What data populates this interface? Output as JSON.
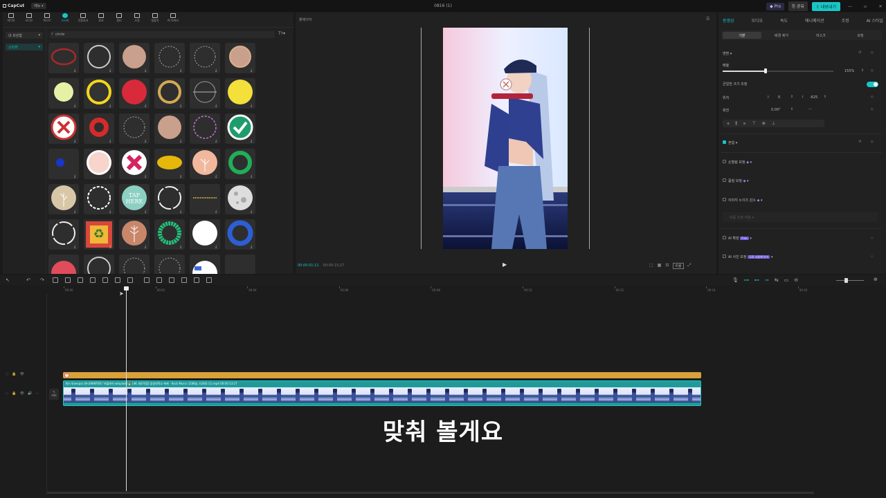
{
  "app": {
    "name": "CapCut",
    "menu_label": "메뉴",
    "project_title": "0816 (1)"
  },
  "top_buttons": {
    "pro": "Pro",
    "share": "공유",
    "export": "내보내기"
  },
  "toolbar": [
    {
      "label": "미디어",
      "icon": "media-icon"
    },
    {
      "label": "오디오",
      "icon": "audio-icon"
    },
    {
      "label": "텍스트",
      "icon": "text-icon"
    },
    {
      "label": "스티커",
      "icon": "sticker-icon",
      "active": true
    },
    {
      "label": "전환효과",
      "icon": "transition-icon"
    },
    {
      "label": "효과",
      "icon": "effect-icon"
    },
    {
      "label": "필터",
      "icon": "filter-icon"
    },
    {
      "label": "조정",
      "icon": "adjust-icon"
    },
    {
      "label": "템플릿",
      "icon": "template-icon"
    },
    {
      "label": "AI 아바타",
      "icon": "avatar-icon"
    }
  ],
  "sidebar": {
    "my_label": "내 보관함",
    "sticker_label": "스티커"
  },
  "search": {
    "value": "circle"
  },
  "sticker_grid": [
    {
      "kind": "red-ring"
    },
    {
      "kind": "gray-ring"
    },
    {
      "kind": "tan-circle"
    },
    {
      "kind": "dotted-ring"
    },
    {
      "kind": "dotted-ring"
    },
    {
      "kind": "tan-circle-ring"
    },
    {
      "kind": "lime-circle"
    },
    {
      "kind": "yellow-ring"
    },
    {
      "kind": "red-circle"
    },
    {
      "kind": "gold-ring"
    },
    {
      "kind": "line-ring"
    },
    {
      "kind": "yellow-circle"
    },
    {
      "kind": "x-circle"
    },
    {
      "kind": "red-target"
    },
    {
      "kind": "dotted-ring"
    },
    {
      "kind": "tan-circle"
    },
    {
      "kind": "pink-dash-ring"
    },
    {
      "kind": "check-circle"
    },
    {
      "kind": "blue-dot"
    },
    {
      "kind": "pink-circle"
    },
    {
      "kind": "x-pink"
    },
    {
      "kind": "yellow-ellipse"
    },
    {
      "kind": "peach-flower"
    },
    {
      "kind": "green-ring"
    },
    {
      "kind": "beige-flower"
    },
    {
      "kind": "laurel-ring"
    },
    {
      "kind": "tap-here"
    },
    {
      "kind": "brush-ring"
    },
    {
      "kind": "gold-dots"
    },
    {
      "kind": "moon"
    },
    {
      "kind": "brush-ring"
    },
    {
      "kind": "recycle"
    },
    {
      "kind": "leaf-circle"
    },
    {
      "kind": "green-dash-ring"
    },
    {
      "kind": "white-circle"
    },
    {
      "kind": "blue-ring"
    },
    {
      "kind": "red-partial"
    },
    {
      "kind": "gray-ring"
    },
    {
      "kind": "dotted-ring"
    },
    {
      "kind": "dotted-ring"
    },
    {
      "kind": "white-blue"
    },
    {
      "kind": "empty"
    }
  ],
  "tap_here_text": "TAP HERE",
  "player": {
    "header": "플레이어",
    "current_time": "00:00:01:11",
    "total_time": "00:00:13:27",
    "ratio_label": "비율"
  },
  "right_panel": {
    "tabs": [
      "동영상",
      "오디오",
      "속도",
      "애니메이션",
      "조정",
      "AI 스타일"
    ],
    "subtabs": [
      "기본",
      "배경 제거",
      "마스크",
      "보정"
    ],
    "transform": "변환",
    "scale_label": "배율",
    "scale_value": "155%",
    "uniform_scale": "균일한 크기 조정",
    "position_label": "위치",
    "x_label": "X",
    "x_value": "0",
    "y_label": "Y",
    "y_value": "-625",
    "rotation_label": "회전",
    "rotation_value": "0.00°",
    "blend": "혼합",
    "stabilize": "손떨림 보정",
    "enhance": "품질 보정",
    "denoise": "이미지 노이즈 감소",
    "auto_adjust": "자동 조정 적용",
    "ai_expand": "AI 확장",
    "ai_fix": "AI 사진 보정",
    "free_badge": "Free",
    "trial_badge": "무료 사용해 보기"
  },
  "timeline": {
    "ruler": [
      "00:00",
      "00:02",
      "00:04",
      "00:06",
      "00:08",
      "00:10",
      "00:12",
      "00:14",
      "00:16"
    ],
    "clip_label": "개스가(aespa) 윈터(WINTER) '위플래쉬 whiplash'🔥 [4K 세로직캠] 잠실대학교 축제 - Rock Music (1080p, h264) (1).mp4",
    "clip_duration": "00:00:13:27",
    "cover_label": "커버",
    "playhead_time": 1.38,
    "total_duration": 13.9
  },
  "caption": "맞춰 볼게요",
  "colors": {
    "accent": "#19c5c5",
    "sticker_track": "#d8a13a",
    "video_track": "#1f9a9a",
    "bg": "#1a1a1a"
  }
}
